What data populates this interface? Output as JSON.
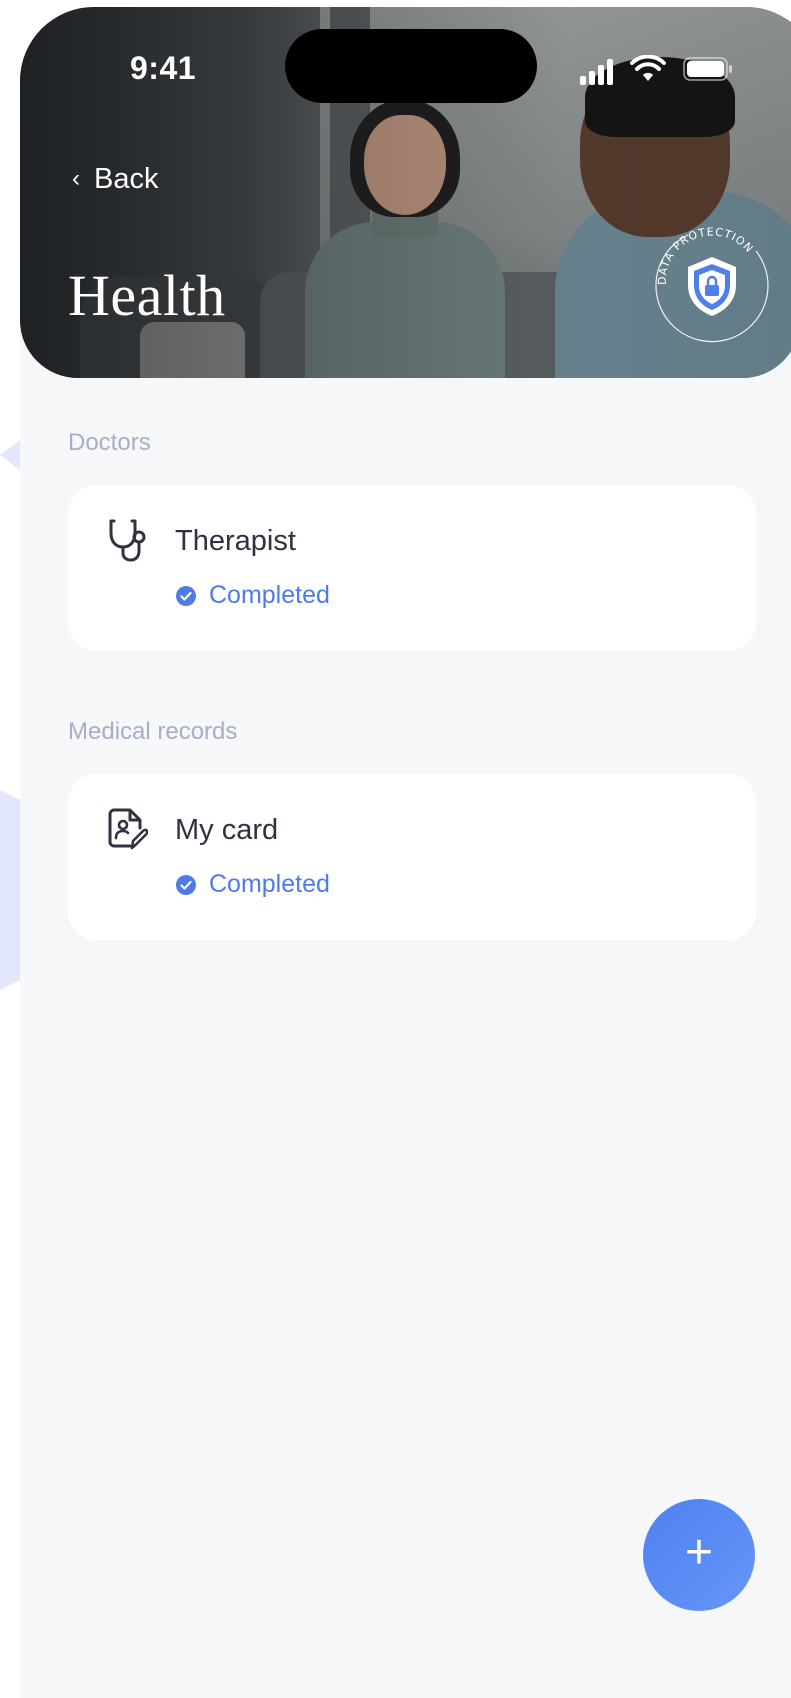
{
  "status_bar": {
    "time": "9:41"
  },
  "header": {
    "back_label": "Back",
    "title": "Health",
    "badge_text": "DATA PROTECTION"
  },
  "sections": [
    {
      "label": "Doctors",
      "cards": [
        {
          "title": "Therapist",
          "status": "Completed",
          "icon": "stethoscope-icon"
        }
      ]
    },
    {
      "label": "Medical records",
      "cards": [
        {
          "title": "My card",
          "status": "Completed",
          "icon": "medical-file-icon"
        }
      ]
    }
  ],
  "fab": {
    "icon": "plus-icon",
    "label": "+"
  },
  "colors": {
    "accent": "#4d7be8",
    "section_label": "#a7aec8",
    "background": "#f5f7f9",
    "card": "#ffffff"
  }
}
